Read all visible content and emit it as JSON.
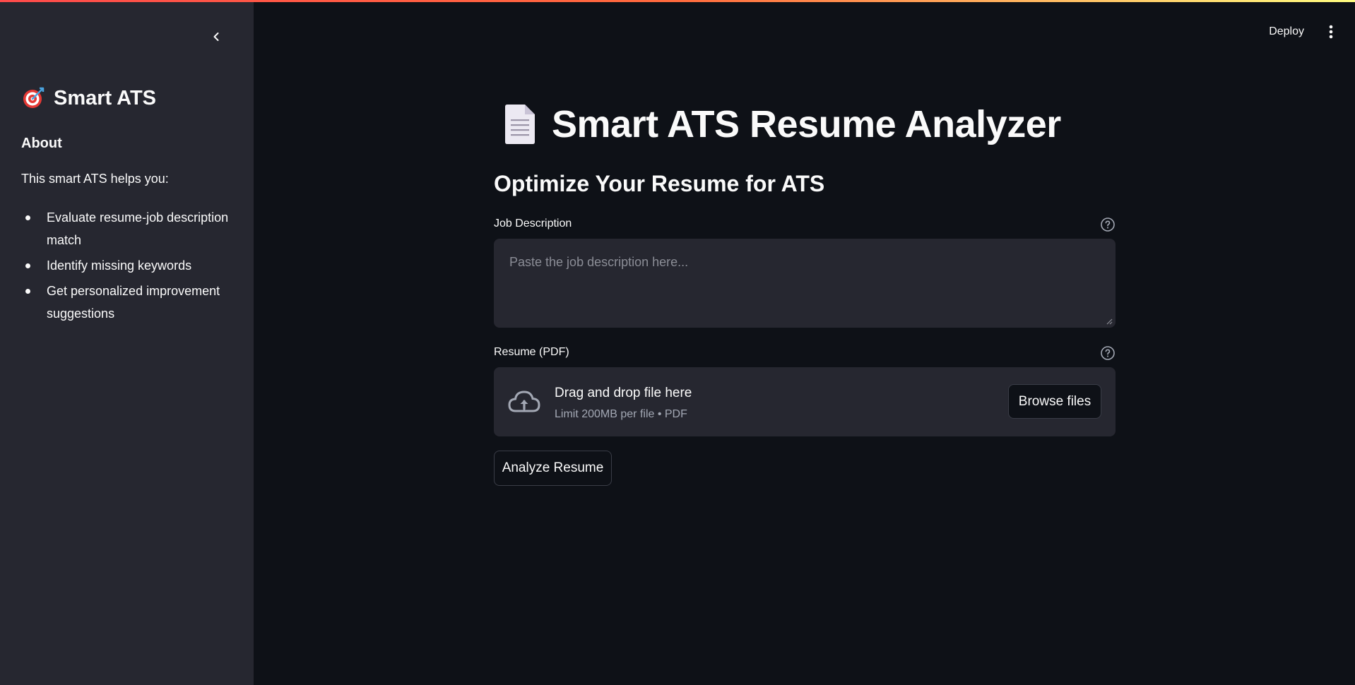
{
  "sidebar": {
    "title": "Smart ATS",
    "title_icon": "target-icon",
    "about_heading": "About",
    "intro": "This smart ATS helps you:",
    "items": [
      {
        "label": "Evaluate resume-job description match"
      },
      {
        "label": "Identify missing keywords"
      },
      {
        "label": "Get personalized improvement suggestions"
      }
    ]
  },
  "header": {
    "deploy_label": "Deploy"
  },
  "main": {
    "title": "Smart ATS Resume Analyzer",
    "title_icon": "document-icon",
    "subtitle": "Optimize Your Resume for ATS",
    "job_description": {
      "label": "Job Description",
      "placeholder": "Paste the job description here...",
      "value": ""
    },
    "resume": {
      "label": "Resume (PDF)",
      "drag_text": "Drag and drop file here",
      "limit_text": "Limit 200MB per file • PDF",
      "browse_label": "Browse files"
    },
    "analyze_label": "Analyze Resume"
  },
  "colors": {
    "background": "#0e1117",
    "sidebar": "#262730",
    "text": "#fafafa",
    "accent_start": "#ff4b4b",
    "accent_end": "#fffd80"
  }
}
